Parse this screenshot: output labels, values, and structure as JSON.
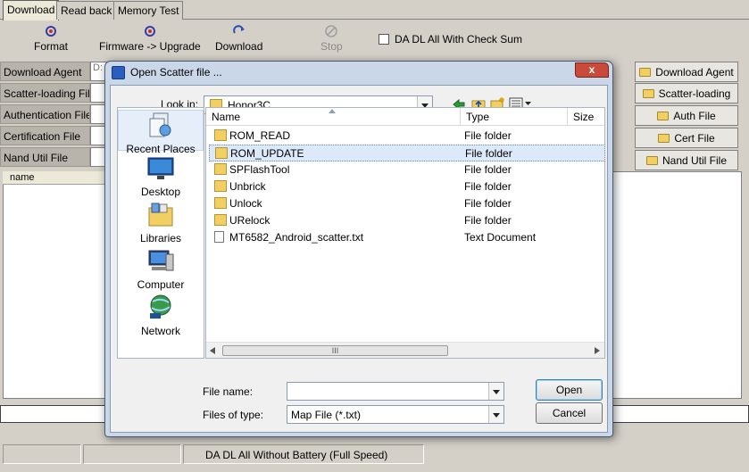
{
  "tabs": [
    "Download",
    "Read back",
    "Memory Test"
  ],
  "toolbar": {
    "format": "Format",
    "firmware_upgrade": "Firmware -> Upgrade",
    "download": "Download",
    "stop": "Stop",
    "da_dl_checksum": "DA DL All With Check Sum"
  },
  "fields": {
    "labels": [
      "Download Agent",
      "Scatter-loading File",
      "Authentication File",
      "Certification File",
      "Nand Util File"
    ],
    "download_agent_value": "D:"
  },
  "right_buttons": [
    "Download Agent",
    "Scatter-loading",
    "Auth File",
    "Cert File",
    "Nand Util File"
  ],
  "list_header": "name",
  "status_text": "DA DL All Without Battery (Full Speed)",
  "dialog": {
    "title": "Open Scatter file ...",
    "look_in_label": "Look in:",
    "look_in_value": "Honor3C",
    "places": [
      "Recent Places",
      "Desktop",
      "Libraries",
      "Computer",
      "Network"
    ],
    "columns": [
      "Name",
      "Type",
      "Size"
    ],
    "files": [
      {
        "name": "ROM_READ",
        "type": "File folder",
        "icon": "folder-icon"
      },
      {
        "name": "ROM_UPDATE",
        "type": "File folder",
        "icon": "folder-icon",
        "selected": true
      },
      {
        "name": "SPFlashTool",
        "type": "File folder",
        "icon": "folder-icon"
      },
      {
        "name": "Unbrick",
        "type": "File folder",
        "icon": "folder-icon"
      },
      {
        "name": "Unlock",
        "type": "File folder",
        "icon": "folder-icon"
      },
      {
        "name": "URelock",
        "type": "File folder",
        "icon": "folder-icon"
      },
      {
        "name": "MT6582_Android_scatter.txt",
        "type": "Text Document",
        "icon": "text-file-icon"
      }
    ],
    "file_name_label": "File name:",
    "file_name_value": "",
    "files_of_type_label": "Files of type:",
    "files_of_type_value": "Map File (*.txt)",
    "open_button": "Open",
    "cancel_button": "Cancel",
    "close_glyph": "x",
    "scroll_grip": "III"
  },
  "colors": {
    "dialog_frame": "#c9d7e8",
    "selection": "#dce9fa",
    "app_bg": "#d4d0c8"
  }
}
